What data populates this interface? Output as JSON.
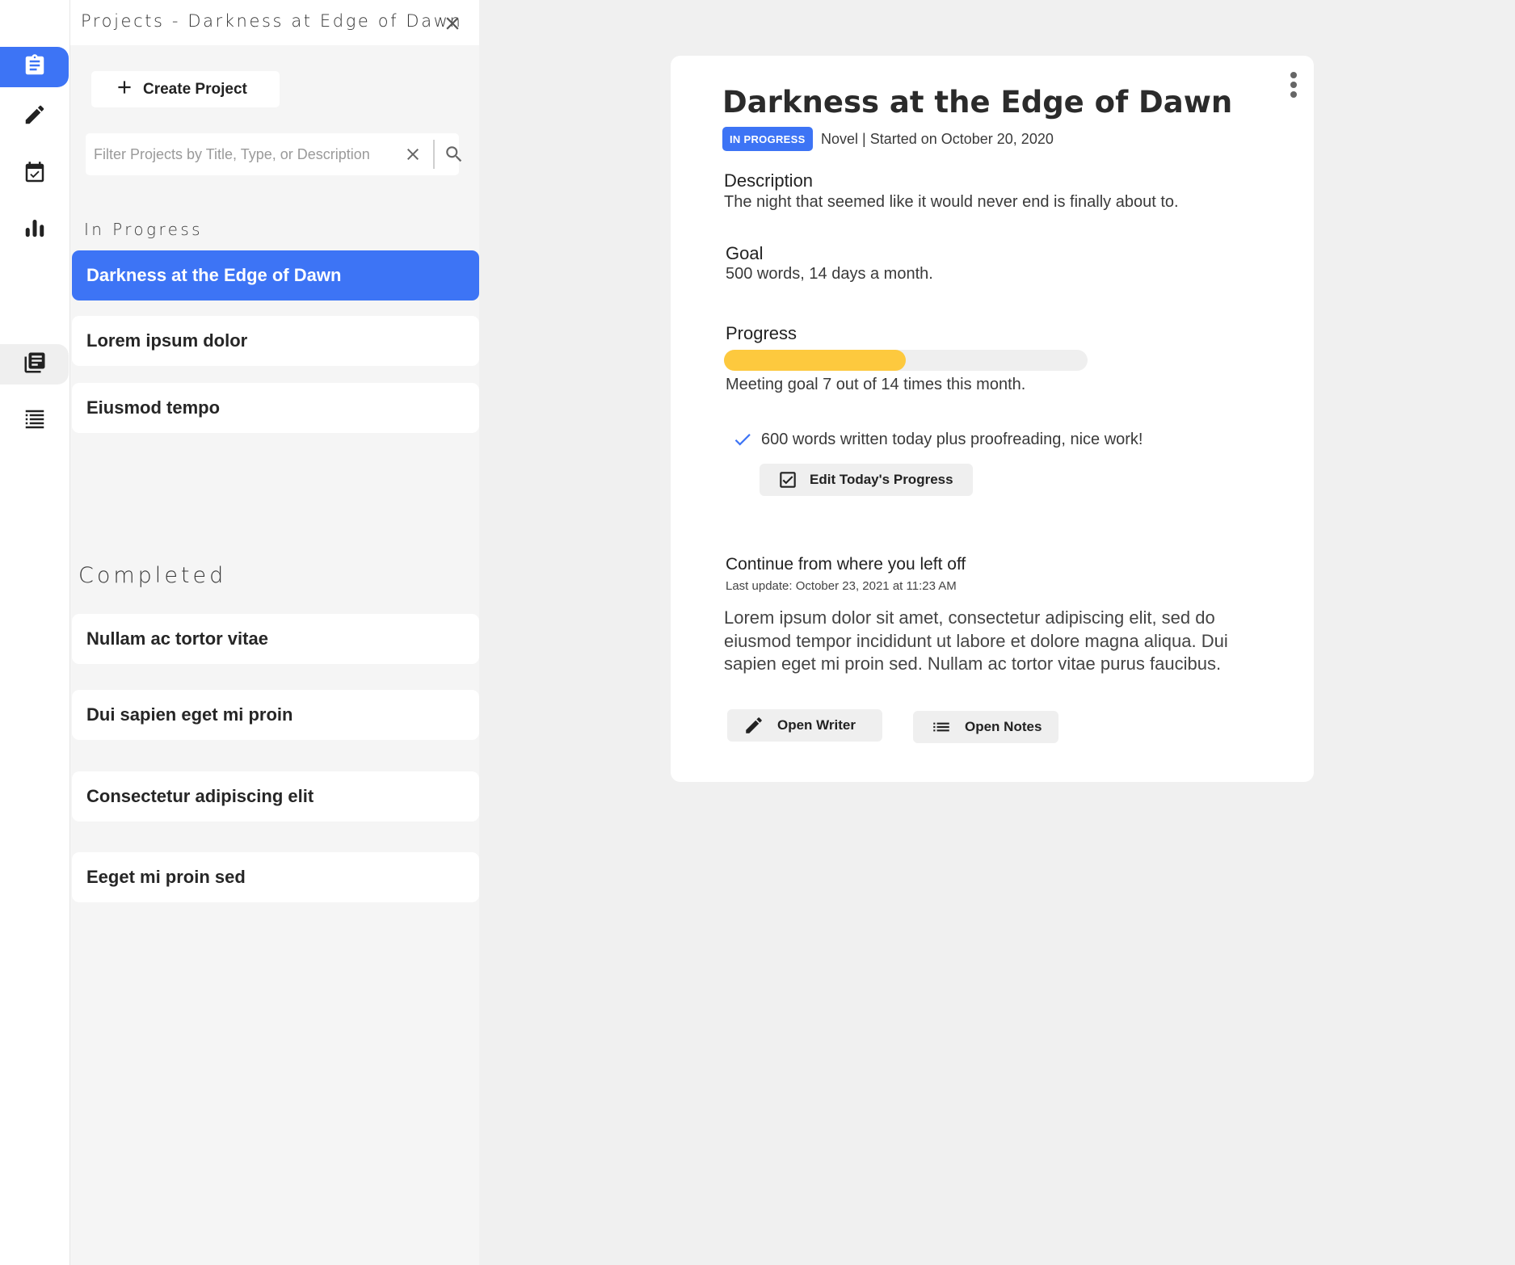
{
  "rail": {
    "items": [
      {
        "name": "projects",
        "icon": "clipboard-icon",
        "active": true
      },
      {
        "name": "write",
        "icon": "pencil-icon"
      },
      {
        "name": "calendar",
        "icon": "calendar-check-icon"
      },
      {
        "name": "stats",
        "icon": "bar-chart-icon"
      },
      {
        "name": "library",
        "icon": "library-icon",
        "highlighted": true
      },
      {
        "name": "list",
        "icon": "list-icon"
      }
    ],
    "accent": "#3d74f5"
  },
  "panel": {
    "title": "Projects - Darkness at Edge of Dawn",
    "create_label": "Create Project",
    "filter_placeholder": "Filter Projects by Title, Type, or Description",
    "in_progress_label": "In Progress",
    "completed_label": "Completed",
    "in_progress": [
      {
        "title": "Darkness at the Edge of Dawn",
        "active": true
      },
      {
        "title": "Lorem ipsum dolor"
      },
      {
        "title": "Eiusmod tempo"
      }
    ],
    "completed": [
      {
        "title": "Nullam ac tortor vitae"
      },
      {
        "title": "Dui sapien eget mi proin"
      },
      {
        "title": "Consectetur adipiscing elit"
      },
      {
        "title": "Eeget mi proin sed"
      }
    ]
  },
  "detail": {
    "title": "Darkness at the Edge of Dawn",
    "status": "IN PROGRESS",
    "meta": "Novel | Started on October 20, 2020",
    "description_label": "Description",
    "description": "The night that seemed like it would never end is finally about to.",
    "goal_label": "Goal",
    "goal": "500 words, 14 days a month.",
    "progress_label": "Progress",
    "progress_fraction": 0.5,
    "progress_text": "Meeting goal 7 out of 14 times this month.",
    "today_note": "600 words written today plus proofreading, nice work!",
    "edit_progress_label": "Edit Today's Progress",
    "continue_label": "Continue from where you left off",
    "last_update": "Last update: October 23, 2021 at 11:23 AM",
    "excerpt": "Lorem ipsum dolor sit amet, consectetur adipiscing elit, sed do eiusmod tempor incididunt ut labore et dolore magna aliqua. Dui sapien eget mi proin sed. Nullam ac tortor vitae purus faucibus.",
    "open_writer_label": "Open Writer",
    "open_notes_label": "Open Notes",
    "progress_color": "#fdc93e"
  }
}
